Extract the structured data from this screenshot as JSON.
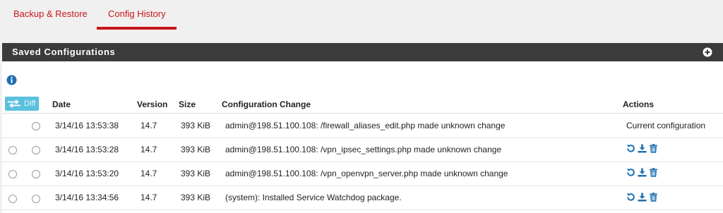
{
  "tabs": [
    {
      "label": "Backup & Restore",
      "active": false
    },
    {
      "label": "Config History",
      "active": true
    }
  ],
  "panel": {
    "title": "Saved Configurations"
  },
  "diff_button": {
    "label": "Diff"
  },
  "table": {
    "headers": {
      "date": "Date",
      "version": "Version",
      "size": "Size",
      "change": "Configuration Change",
      "actions": "Actions"
    },
    "rows": [
      {
        "date": "3/14/16 13:53:38",
        "version": "14.7",
        "size": "393 KiB",
        "change": "admin@198.51.100.108: /firewall_aliases_edit.php made unknown change",
        "actions_text": "Current configuration"
      },
      {
        "date": "3/14/16 13:53:28",
        "version": "14.7",
        "size": "393 KiB",
        "change": "admin@198.51.100.108: /vpn_ipsec_settings.php made unknown change",
        "actions": [
          "restore-icon",
          "download-icon",
          "trash-icon"
        ]
      },
      {
        "date": "3/14/16 13:53:20",
        "version": "14.7",
        "size": "393 KiB",
        "change": "admin@198.51.100.108: /vpn_openvpn_server.php made unknown change",
        "actions": [
          "restore-icon",
          "download-icon",
          "trash-icon"
        ]
      },
      {
        "date": "3/14/16 13:34:56",
        "version": "14.7",
        "size": "393 KiB",
        "change": "(system): Installed Service Watchdog package.",
        "actions": [
          "restore-icon",
          "download-icon",
          "trash-icon"
        ]
      }
    ]
  },
  "colors": {
    "accent": "#c8161d",
    "panel_header": "#3b3b3b",
    "diff_button": "#5bc0de",
    "info_icon": "#1e6fb0",
    "action_icons": "#1e6fb0"
  }
}
